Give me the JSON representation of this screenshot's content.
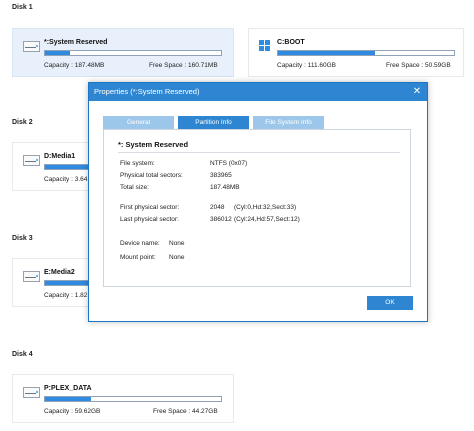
{
  "disks": [
    {
      "label": "Disk 1",
      "partitions": [
        {
          "name": "*:System Reserved",
          "capacity": "Capacity : 187.48MB",
          "free": "Free Space : 160.71MB",
          "used_fraction": 0.14,
          "icon": "drive-icon",
          "selected": true
        },
        {
          "name": "C:BOOT",
          "capacity": "Capacity : 111.60GB",
          "free": "Free Space : 50.59GB",
          "used_fraction": 0.55,
          "icon": "windows-icon",
          "selected": false
        }
      ]
    },
    {
      "label": "Disk 2",
      "partitions": [
        {
          "name": "D:Media1",
          "capacity": "Capacity : 3.64",
          "icon": "drive-icon"
        }
      ]
    },
    {
      "label": "Disk 3",
      "partitions": [
        {
          "name": "E:Media2",
          "capacity": "Capacity : 1.82",
          "icon": "drive-icon"
        }
      ]
    },
    {
      "label": "Disk 4",
      "partitions": [
        {
          "name": "P:PLEX_DATA",
          "capacity": "Capacity : 59.62GB",
          "free": "Free Space : 44.27GB",
          "used_fraction": 0.26,
          "icon": "drive-icon"
        }
      ]
    }
  ],
  "dialog": {
    "title": "Properties (*:System Reserved)",
    "tabs": [
      "General",
      "Partition Info",
      "File System Info"
    ],
    "active_tab": "Partition Info",
    "partition_title": "*: System Reserved",
    "rows": {
      "file_system": {
        "label": "File system:",
        "value": "NTFS (0x07)"
      },
      "physical_total": {
        "label": "Physical total sectors:",
        "value": "383965"
      },
      "total_size": {
        "label": "Total size:",
        "value": "187.48MB"
      },
      "first_sector": {
        "label": "First physical sector:",
        "value": "2048",
        "detail": "(Cyl:0,Hd:32,Sect:33)"
      },
      "last_sector": {
        "label": "Last physical sector:",
        "value": "386012",
        "detail": "(Cyl:24,Hd:57,Sect:12)"
      },
      "device_name": {
        "label": "Device name:",
        "value": "None"
      },
      "mount_point": {
        "label": "Mount point:",
        "value": "None"
      }
    },
    "ok_label": "OK",
    "close_glyph": "✕"
  },
  "colors": {
    "accent": "#2e86d3",
    "bar_fill": "#2f8ae0",
    "tab_inactive": "#9cc7ea",
    "selected_card": "#e8f1fb"
  }
}
